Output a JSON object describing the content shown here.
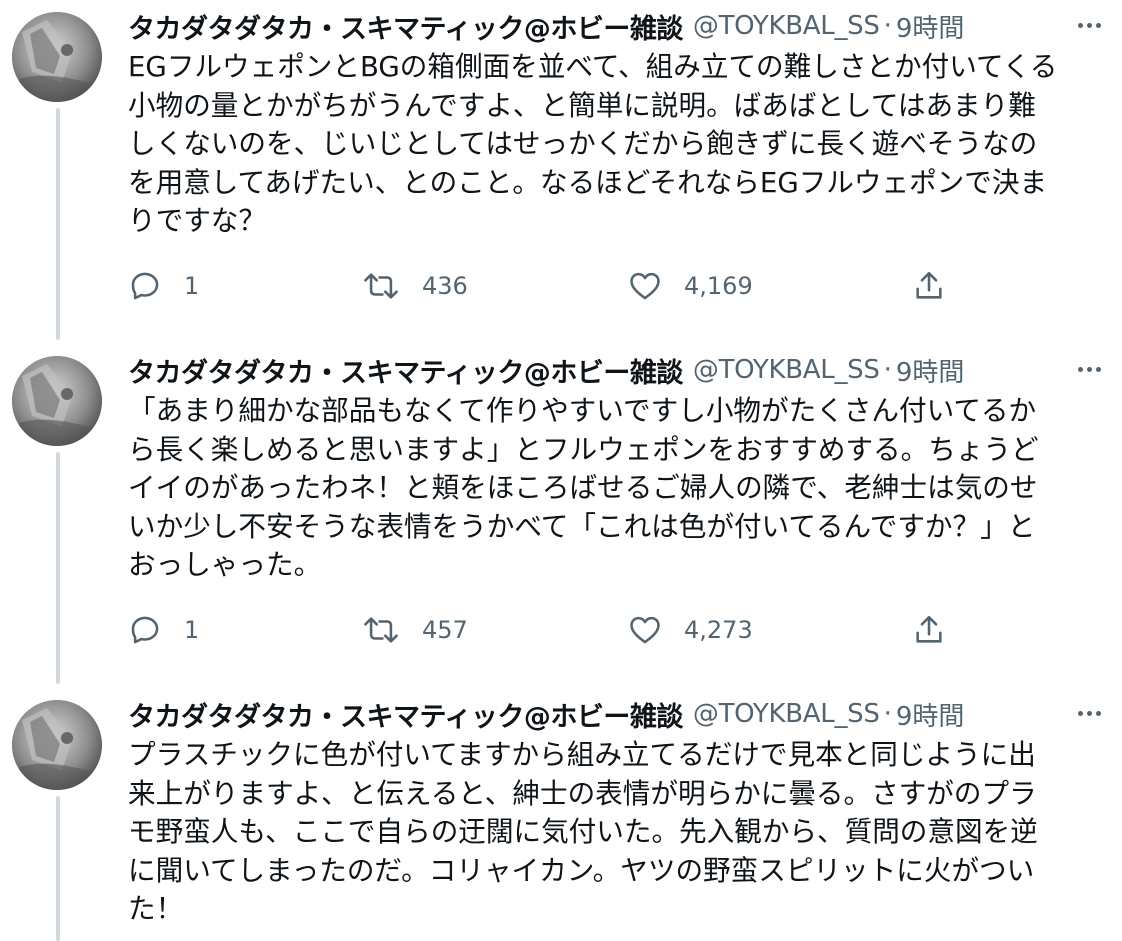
{
  "tweets": [
    {
      "author_name": "タカダタダタカ・スキマティック@ホビー雑談",
      "handle": "@TOYKBAL_SS",
      "separator": "·",
      "time": "9時間",
      "text": "EGフルウェポンとBGの箱側面を並べて、組み立ての難しさとか付いてくる\n小物の量とかがちがうんですよ、と簡単に説明。ばあばとしてはあまり難\nしくないのを、じいじとしてはせっかくだから飽きずに長く遊べそうなの\nを用意してあげたい、とのこと。なるほどそれならEGフルウェポンで決ま\nりですな？",
      "reply_count": "1",
      "retweet_count": "436",
      "like_count": "4,169"
    },
    {
      "author_name": "タカダタダタカ・スキマティック@ホビー雑談",
      "handle": "@TOYKBAL_SS",
      "separator": "·",
      "time": "9時間",
      "text": "「あまり細かな部品もなくて作りやすいですし小物がたくさん付いてるか\nら長く楽しめると思いますよ」とフルウェポンをおすすめする。ちょうど\nイイのがあったわネ！と頬をほころばせるご婦人の隣で、老紳士は気のせ\nいか少し不安そうな表情をうかべて「これは色が付いてるんですか？」と\nおっしゃった。",
      "reply_count": "1",
      "retweet_count": "457",
      "like_count": "4,273"
    },
    {
      "author_name": "タカダタダタカ・スキマティック@ホビー雑談",
      "handle": "@TOYKBAL_SS",
      "separator": "·",
      "time": "9時間",
      "text": "プラスチックに色が付いてますから組み立てるだけで見本と同じように出\n来上がりますよ、と伝えると、紳士の表情が明らかに曇る。さすがのプラ\nモ野蛮人も、ここで自らの迂闊に気付いた。先入観から、質問の意図を逆\nに聞いてしまったのだ。コリャイカン。ヤツの野蛮スピリットに火がつい\nた！",
      "reply_count": "",
      "retweet_count": "",
      "like_count": ""
    }
  ],
  "icons": {
    "reply": "reply-icon",
    "retweet": "retweet-icon",
    "like": "heart-icon",
    "share": "share-icon",
    "more": "more-options-icon"
  },
  "colors": {
    "text_primary": "#0f1419",
    "text_secondary": "#536471",
    "thread_line": "#cfd9de"
  }
}
